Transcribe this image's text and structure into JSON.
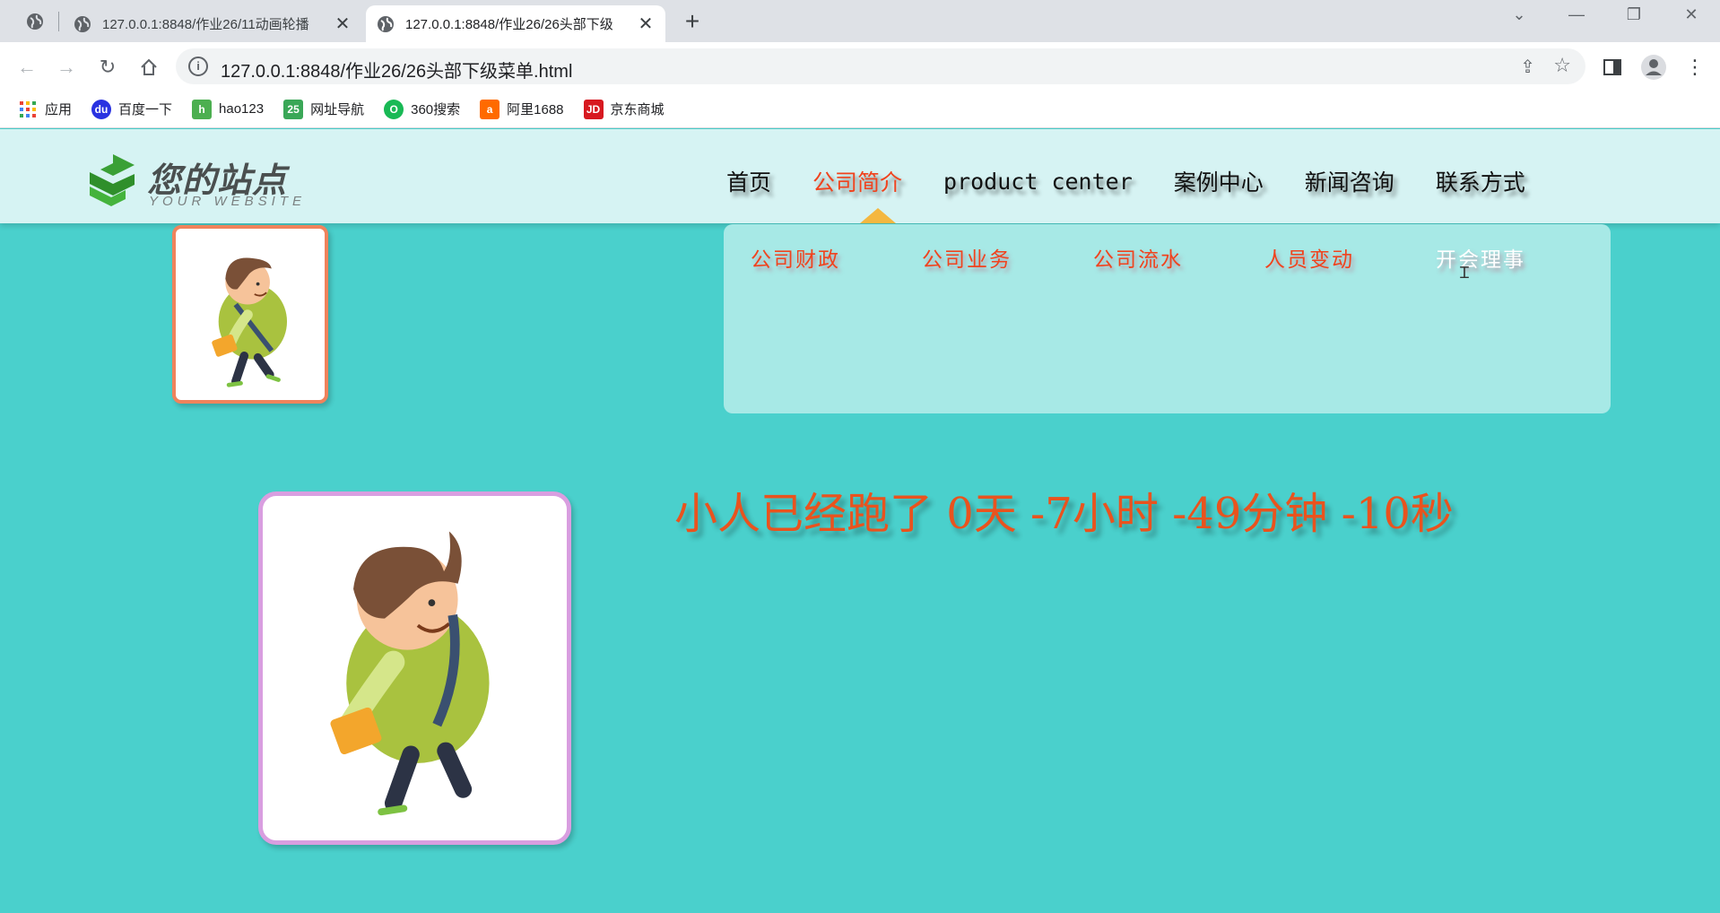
{
  "browser": {
    "tabs": [
      {
        "title": "127.0.0.1:8848/作业26/11动画轮播"
      },
      {
        "title": "127.0.0.1:8848/作业26/26头部下级"
      }
    ],
    "url": "127.0.0.1:8848/作业26/26头部下级菜单.html",
    "bookmarks": [
      {
        "label": "应用",
        "icon": "apps-grid-icon"
      },
      {
        "label": "百度一下",
        "icon": "baidu-paw-icon"
      },
      {
        "label": "hao123",
        "icon": "hao123-icon"
      },
      {
        "label": "网址导航",
        "icon": "2345-icon"
      },
      {
        "label": "360搜索",
        "icon": "360-search-icon"
      },
      {
        "label": "阿里1688",
        "icon": "ali1688-icon"
      },
      {
        "label": "京东商城",
        "icon": "jd-icon"
      }
    ]
  },
  "site": {
    "logo_cn": "您的站点",
    "logo_en": "YOUR WEBSITE",
    "nav": [
      "首页",
      "公司简介",
      "product center",
      "案例中心",
      "新闻咨询",
      "联系方式"
    ],
    "active_nav": "公司简介",
    "submenu": [
      "公司财政",
      "公司业务",
      "公司流水",
      "人员变动",
      "开会理事"
    ],
    "hovered_submenu": "开会理事",
    "countdown": "小人已经跑了 0天 -7小时 -49分钟 -10秒"
  },
  "colors": {
    "page_bg": "#4ad0cc",
    "header_bg": "#d6f3f3",
    "dropdown_bg": "#a7e9e6",
    "accent": "#f0431e",
    "caret": "#f4b740",
    "small_frame": "#f0835c",
    "large_frame": "#d99ee0"
  }
}
